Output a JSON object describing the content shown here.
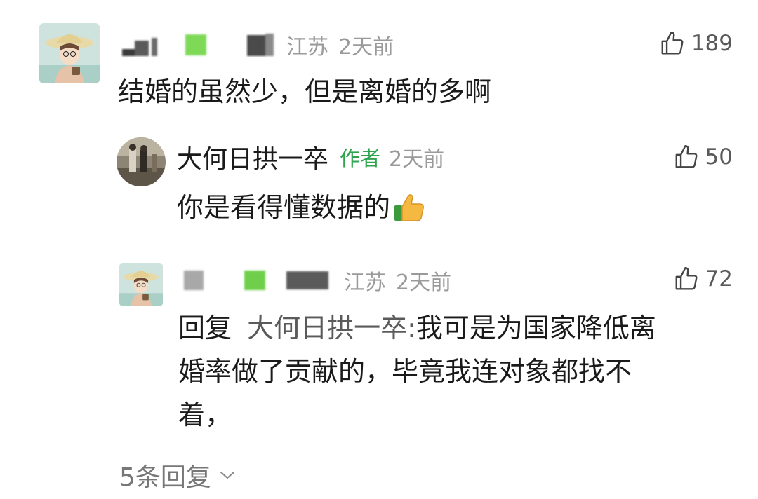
{
  "comment": {
    "location": "江苏",
    "time": "2天前",
    "likes": "189",
    "text": "结婚的虽然少，但是离婚的多啊"
  },
  "author_reply": {
    "name": "大何日拱一卒",
    "badge": "作者",
    "time": "2天前",
    "likes": "50",
    "text": "你是看得懂数据的"
  },
  "second_reply": {
    "location": "江苏",
    "time": "2天前",
    "likes": "72",
    "reply_prefix": "回复",
    "reply_target": "大何日拱一卒:",
    "line1": "我可是为国家降低离",
    "line2": "婚率做了贡献的，毕竟我连对象都找不",
    "line3": "着，"
  },
  "more_replies": "5条回复",
  "colors": {
    "author_badge": "#2ea44f",
    "meta_gray": "#9a9a9a",
    "text": "#1a1a1a"
  },
  "icons": {
    "like": "thumbs-up-icon",
    "emoji": "thumbs-up-emoji-icon",
    "expand": "chevron-down-icon"
  }
}
